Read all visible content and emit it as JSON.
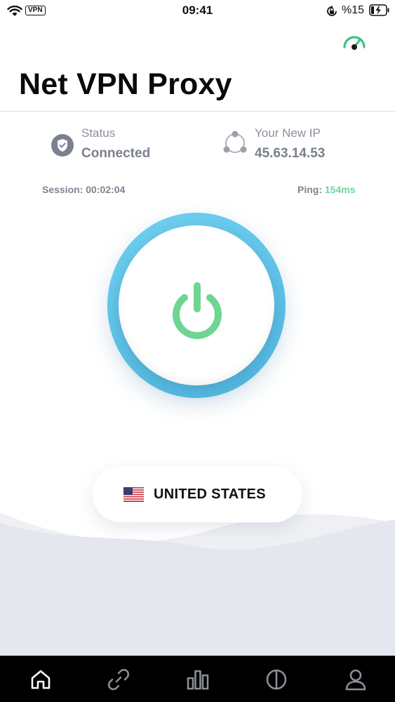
{
  "status_bar": {
    "time": "09:41",
    "vpn_badge": "VPN",
    "battery_percent": "%15",
    "icons": [
      "wifi-icon",
      "orientation-lock-icon",
      "battery-charging-icon"
    ]
  },
  "header": {
    "title": "Net VPN Proxy",
    "speed_icon": "speedometer-icon"
  },
  "info": {
    "status_label": "Status",
    "status_value": "Connected",
    "ip_label": "Your New IP",
    "ip_value": "45.63.14.53",
    "session_text": "Session: 00:02:04",
    "ping_label": "Ping:",
    "ping_value": "154ms"
  },
  "connect_button": {
    "icon": "power-icon"
  },
  "location": {
    "country": "UNITED STATES",
    "flag_icon": "us-flag-icon"
  },
  "tabs": [
    {
      "icon": "home-icon"
    },
    {
      "icon": "link-icon"
    },
    {
      "icon": "bar-chart-icon"
    },
    {
      "icon": "half-circle-icon"
    },
    {
      "icon": "user-icon"
    }
  ],
  "colors": {
    "ring": "#5cc3ea",
    "power": "#6ed692",
    "ping": "#6bd69a",
    "speed_icon": "#3fbf7f"
  }
}
